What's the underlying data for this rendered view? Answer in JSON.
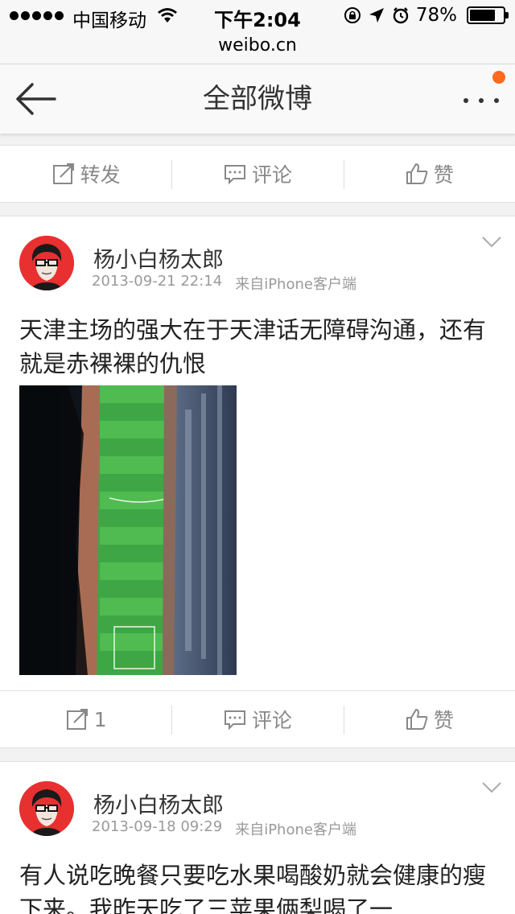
{
  "status_bar": {
    "carrier": "中国移动",
    "time": "下午2:04",
    "battery_percent": "78%",
    "battery_level": 0.78
  },
  "url_bar": {
    "url": "weibo.cn"
  },
  "header": {
    "title": "全部微博"
  },
  "actions_top": {
    "repost_label": "转发",
    "comment_label": "评论",
    "like_label": "赞"
  },
  "posts": [
    {
      "author": "杨小白杨太郎",
      "timestamp": "2013-09-21 22:14",
      "source": "来自iPhone客户端",
      "text": "天津主场的强大在于天津话无障碍沟通，还有就是赤裸裸的仇恨",
      "image_icon": "stadium-photo",
      "actions": {
        "repost_label": "1",
        "comment_label": "评论",
        "like_label": "赞"
      }
    },
    {
      "author": "杨小白杨太郎",
      "timestamp": "2013-09-18 09:29",
      "source": "来自iPhone客户端",
      "text": "有人说吃晚餐只要吃水果喝酸奶就会健康的瘦下来。我昨天吃了三苹果俩梨喝了一"
    }
  ],
  "colors": {
    "accent": "#ff6a1f",
    "avatar_bg": "#e83030",
    "muted": "#9a9a9a"
  }
}
